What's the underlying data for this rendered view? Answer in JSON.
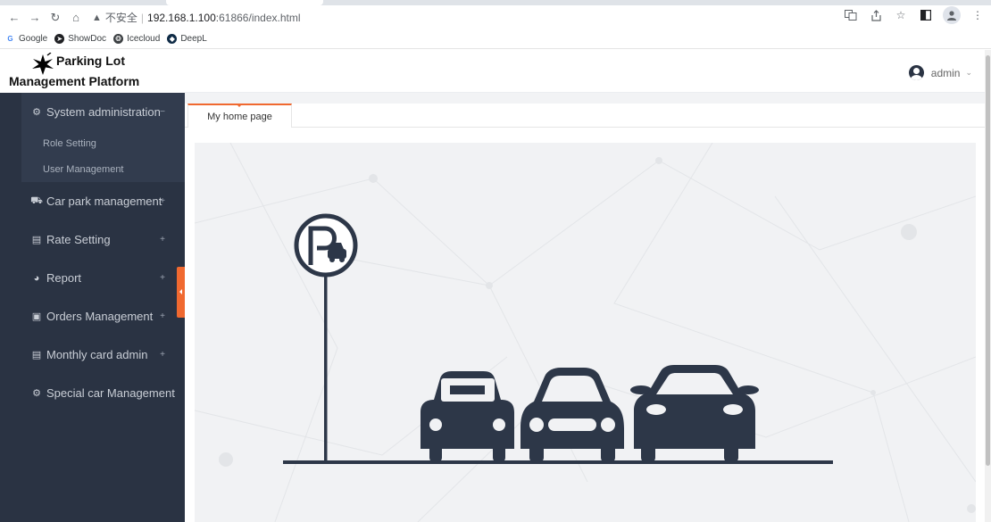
{
  "browser": {
    "url_warning": "不安全",
    "url_host": "192.168.1.100",
    "url_path": ":61866/index.html",
    "bookmarks": [
      {
        "label": "Google",
        "icon": "google-icon",
        "color": "#4285f4"
      },
      {
        "label": "ShowDoc",
        "icon": "showdoc-icon",
        "color": "#202124"
      },
      {
        "label": "Icecloud",
        "icon": "icecloud-icon",
        "color": "#3c4043"
      },
      {
        "label": "DeepL",
        "icon": "deepl-icon",
        "color": "#0f2b46"
      }
    ]
  },
  "app": {
    "logo_line1": "Parking Lot",
    "logo_line2": "Management Platform",
    "user": "admin"
  },
  "sidebar": {
    "items": [
      {
        "label": "System administration",
        "icon": "gear-icon",
        "toggle": "−"
      },
      {
        "label": "Car park management",
        "icon": "car-icon",
        "toggle": "+"
      },
      {
        "label": "Rate Setting",
        "icon": "rate-icon",
        "toggle": "+"
      },
      {
        "label": "Report",
        "icon": "pie-chart-icon",
        "toggle": "+"
      },
      {
        "label": "Orders Management",
        "icon": "orders-icon",
        "toggle": "+"
      },
      {
        "label": "Monthly card admin",
        "icon": "card-icon",
        "toggle": "+"
      },
      {
        "label": "Special car Management",
        "icon": "gear-icon",
        "toggle": ""
      }
    ],
    "sub_items": [
      {
        "label": "Role Setting"
      },
      {
        "label": "User Management"
      }
    ]
  },
  "tabs": [
    {
      "label": "My home page"
    }
  ],
  "colors": {
    "sidebar_bg": "#2a3343",
    "accent": "#f06930",
    "illustration": "#2d3748"
  }
}
